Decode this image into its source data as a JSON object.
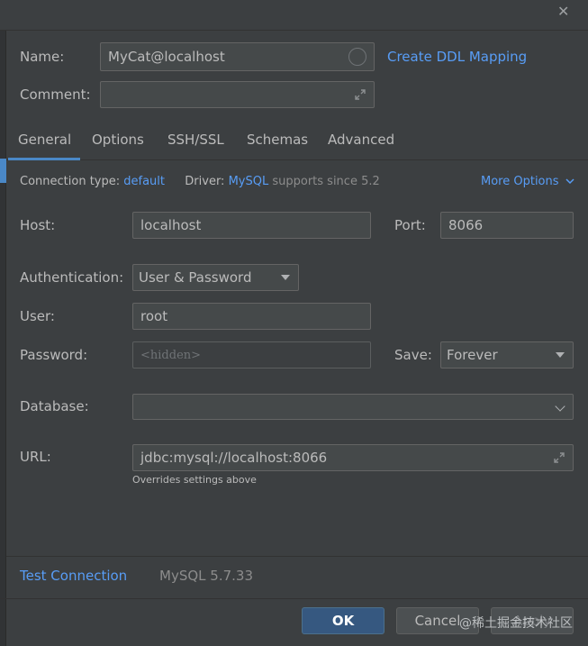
{
  "window": {
    "close_icon": "close-icon"
  },
  "name": {
    "label": "Name:",
    "value": "MyCat@localhost"
  },
  "create_ddl_mapping": "Create DDL Mapping",
  "comment": {
    "label": "Comment:",
    "value": ""
  },
  "tabs": [
    "General",
    "Options",
    "SSH/SSL",
    "Schemas",
    "Advanced"
  ],
  "connection_info": {
    "type_label": "Connection type:",
    "type_value": "default",
    "driver_label": "Driver:",
    "driver_value": "MySQL",
    "driver_suffix": "supports since 5.2",
    "more_options": "More Options"
  },
  "host": {
    "label": "Host:",
    "value": "localhost"
  },
  "port": {
    "label": "Port:",
    "value": "8066"
  },
  "authentication": {
    "label": "Authentication:",
    "selected": "User & Password"
  },
  "user": {
    "label": "User:",
    "value": "root"
  },
  "password": {
    "label": "Password:",
    "placeholder": "<hidden>"
  },
  "save": {
    "label": "Save:",
    "selected": "Forever"
  },
  "database": {
    "label": "Database:",
    "value": ""
  },
  "url": {
    "label": "URL:",
    "value": "jdbc:mysql://localhost:8066",
    "hint": "Overrides settings above"
  },
  "footer": {
    "test_connection": "Test Connection",
    "server_version": "MySQL 5.7.33"
  },
  "buttons": {
    "ok": "OK",
    "cancel": "Cancel",
    "apply": "Apply"
  },
  "watermark": "@稀土掘金技术社区",
  "colors": {
    "accent": "#4a88c7",
    "link": "#589df6",
    "primary_button": "#365880",
    "background": "#3c3f41"
  }
}
